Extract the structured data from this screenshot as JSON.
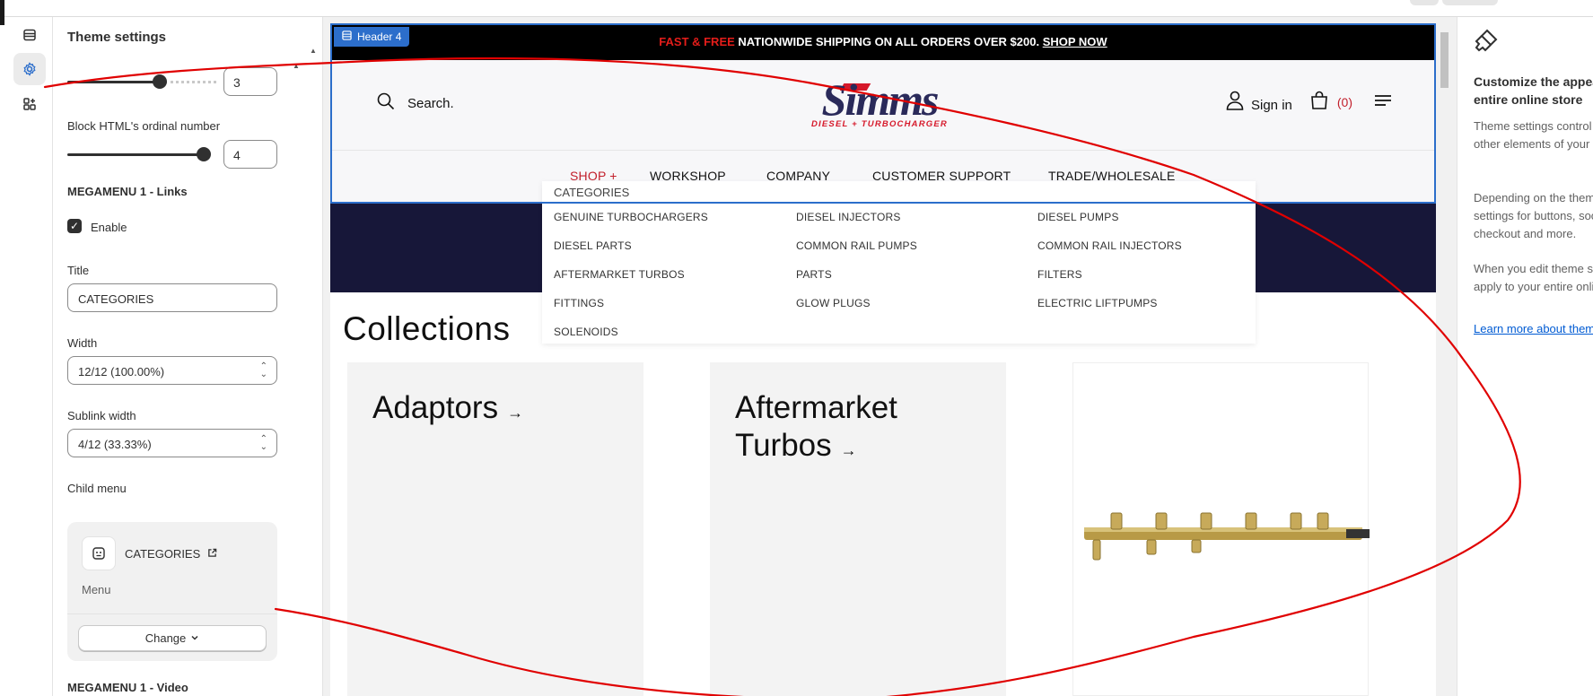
{
  "rail": {
    "icons": [
      "sections-icon",
      "theme-settings-icon",
      "apps-icon"
    ]
  },
  "panel": {
    "title": "Theme settings",
    "slider1_value": "3",
    "slider2_label": "Block HTML's ordinal number",
    "slider2_value": "4",
    "links_heading": "MEGAMENU 1 - Links",
    "enable_label": "Enable",
    "title_label": "Title",
    "title_value": "CATEGORIES",
    "width_label": "Width",
    "width_value": "12/12 (100.00%)",
    "sublink_label": "Sublink width",
    "sublink_value": "4/12 (33.33%)",
    "child_menu_label": "Child menu",
    "child_menu_name": "CATEGORIES",
    "child_menu_type": "Menu",
    "change_label": "Change",
    "video_heading": "MEGAMENU 1 - Video"
  },
  "store": {
    "section_badge": "Header 4",
    "announcement": {
      "prefix": "FAST & FREE",
      "main": "NATIONWIDE SHIPPING ON ALL ORDERS OVER $200.",
      "cta": "SHOP NOW"
    },
    "search_label": "Search.",
    "logo_text": "Simms",
    "logo_tagline": "DIESEL + TURBOCHARGER",
    "signin_label": "Sign in",
    "cart_count": "(0)",
    "nav": [
      "SHOP +",
      "WORKSHOP",
      "COMPANY",
      "CUSTOMER SUPPORT",
      "TRADE/WHOLESALE"
    ],
    "megamenu": {
      "title": "CATEGORIES",
      "links": [
        "GENUINE TURBOCHARGERS",
        "DIESEL INJECTORS",
        "DIESEL PUMPS",
        "DIESEL PARTS",
        "COMMON RAIL PUMPS",
        "COMMON RAIL INJECTORS",
        "AFTERMARKET TURBOS",
        "PARTS",
        "FILTERS",
        "FITTINGS",
        "GLOW PLUGS",
        "ELECTRIC LIFTPUMPS",
        "SOLENOIDS"
      ]
    },
    "collections_heading": "Collections",
    "cards": [
      "Adaptors",
      "Aftermarket Turbos"
    ]
  },
  "right_panel": {
    "heading": "Customize the appearance of your entire online store",
    "p1": "Theme settings control the typography and other elements of your online store.",
    "p2": "Depending on the theme, this can include settings for buttons, social media links, checkout and more.",
    "p3": "When you edit theme settings, changes apply to your entire online store.",
    "link": "Learn more about theme settings"
  },
  "colors": {
    "accent": "#2c6ecb",
    "brand_red": "#c21f2b",
    "annotation": "#e00000",
    "hero": "#171739"
  }
}
